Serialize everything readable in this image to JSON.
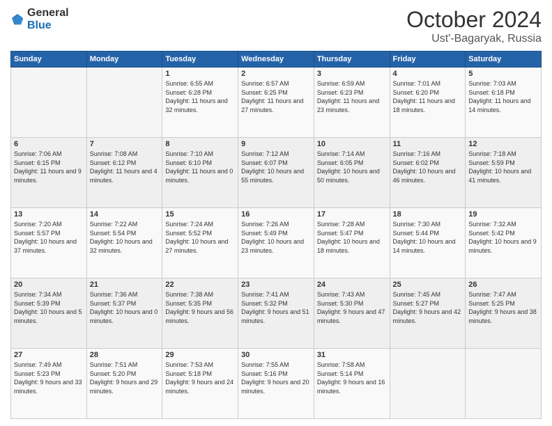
{
  "logo": {
    "general": "General",
    "blue": "Blue"
  },
  "header": {
    "month": "October 2024",
    "location": "Ust'-Bagaryak, Russia"
  },
  "weekdays": [
    "Sunday",
    "Monday",
    "Tuesday",
    "Wednesday",
    "Thursday",
    "Friday",
    "Saturday"
  ],
  "weeks": [
    [
      {
        "day": "",
        "sunrise": "",
        "sunset": "",
        "daylight": ""
      },
      {
        "day": "",
        "sunrise": "",
        "sunset": "",
        "daylight": ""
      },
      {
        "day": "1",
        "sunrise": "Sunrise: 6:55 AM",
        "sunset": "Sunset: 6:28 PM",
        "daylight": "Daylight: 11 hours and 32 minutes."
      },
      {
        "day": "2",
        "sunrise": "Sunrise: 6:57 AM",
        "sunset": "Sunset: 6:25 PM",
        "daylight": "Daylight: 11 hours and 27 minutes."
      },
      {
        "day": "3",
        "sunrise": "Sunrise: 6:59 AM",
        "sunset": "Sunset: 6:23 PM",
        "daylight": "Daylight: 11 hours and 23 minutes."
      },
      {
        "day": "4",
        "sunrise": "Sunrise: 7:01 AM",
        "sunset": "Sunset: 6:20 PM",
        "daylight": "Daylight: 11 hours and 18 minutes."
      },
      {
        "day": "5",
        "sunrise": "Sunrise: 7:03 AM",
        "sunset": "Sunset: 6:18 PM",
        "daylight": "Daylight: 11 hours and 14 minutes."
      }
    ],
    [
      {
        "day": "6",
        "sunrise": "Sunrise: 7:06 AM",
        "sunset": "Sunset: 6:15 PM",
        "daylight": "Daylight: 11 hours and 9 minutes."
      },
      {
        "day": "7",
        "sunrise": "Sunrise: 7:08 AM",
        "sunset": "Sunset: 6:12 PM",
        "daylight": "Daylight: 11 hours and 4 minutes."
      },
      {
        "day": "8",
        "sunrise": "Sunrise: 7:10 AM",
        "sunset": "Sunset: 6:10 PM",
        "daylight": "Daylight: 11 hours and 0 minutes."
      },
      {
        "day": "9",
        "sunrise": "Sunrise: 7:12 AM",
        "sunset": "Sunset: 6:07 PM",
        "daylight": "Daylight: 10 hours and 55 minutes."
      },
      {
        "day": "10",
        "sunrise": "Sunrise: 7:14 AM",
        "sunset": "Sunset: 6:05 PM",
        "daylight": "Daylight: 10 hours and 50 minutes."
      },
      {
        "day": "11",
        "sunrise": "Sunrise: 7:16 AM",
        "sunset": "Sunset: 6:02 PM",
        "daylight": "Daylight: 10 hours and 46 minutes."
      },
      {
        "day": "12",
        "sunrise": "Sunrise: 7:18 AM",
        "sunset": "Sunset: 5:59 PM",
        "daylight": "Daylight: 10 hours and 41 minutes."
      }
    ],
    [
      {
        "day": "13",
        "sunrise": "Sunrise: 7:20 AM",
        "sunset": "Sunset: 5:57 PM",
        "daylight": "Daylight: 10 hours and 37 minutes."
      },
      {
        "day": "14",
        "sunrise": "Sunrise: 7:22 AM",
        "sunset": "Sunset: 5:54 PM",
        "daylight": "Daylight: 10 hours and 32 minutes."
      },
      {
        "day": "15",
        "sunrise": "Sunrise: 7:24 AM",
        "sunset": "Sunset: 5:52 PM",
        "daylight": "Daylight: 10 hours and 27 minutes."
      },
      {
        "day": "16",
        "sunrise": "Sunrise: 7:26 AM",
        "sunset": "Sunset: 5:49 PM",
        "daylight": "Daylight: 10 hours and 23 minutes."
      },
      {
        "day": "17",
        "sunrise": "Sunrise: 7:28 AM",
        "sunset": "Sunset: 5:47 PM",
        "daylight": "Daylight: 10 hours and 18 minutes."
      },
      {
        "day": "18",
        "sunrise": "Sunrise: 7:30 AM",
        "sunset": "Sunset: 5:44 PM",
        "daylight": "Daylight: 10 hours and 14 minutes."
      },
      {
        "day": "19",
        "sunrise": "Sunrise: 7:32 AM",
        "sunset": "Sunset: 5:42 PM",
        "daylight": "Daylight: 10 hours and 9 minutes."
      }
    ],
    [
      {
        "day": "20",
        "sunrise": "Sunrise: 7:34 AM",
        "sunset": "Sunset: 5:39 PM",
        "daylight": "Daylight: 10 hours and 5 minutes."
      },
      {
        "day": "21",
        "sunrise": "Sunrise: 7:36 AM",
        "sunset": "Sunset: 5:37 PM",
        "daylight": "Daylight: 10 hours and 0 minutes."
      },
      {
        "day": "22",
        "sunrise": "Sunrise: 7:38 AM",
        "sunset": "Sunset: 5:35 PM",
        "daylight": "Daylight: 9 hours and 56 minutes."
      },
      {
        "day": "23",
        "sunrise": "Sunrise: 7:41 AM",
        "sunset": "Sunset: 5:32 PM",
        "daylight": "Daylight: 9 hours and 51 minutes."
      },
      {
        "day": "24",
        "sunrise": "Sunrise: 7:43 AM",
        "sunset": "Sunset: 5:30 PM",
        "daylight": "Daylight: 9 hours and 47 minutes."
      },
      {
        "day": "25",
        "sunrise": "Sunrise: 7:45 AM",
        "sunset": "Sunset: 5:27 PM",
        "daylight": "Daylight: 9 hours and 42 minutes."
      },
      {
        "day": "26",
        "sunrise": "Sunrise: 7:47 AM",
        "sunset": "Sunset: 5:25 PM",
        "daylight": "Daylight: 9 hours and 38 minutes."
      }
    ],
    [
      {
        "day": "27",
        "sunrise": "Sunrise: 7:49 AM",
        "sunset": "Sunset: 5:23 PM",
        "daylight": "Daylight: 9 hours and 33 minutes."
      },
      {
        "day": "28",
        "sunrise": "Sunrise: 7:51 AM",
        "sunset": "Sunset: 5:20 PM",
        "daylight": "Daylight: 9 hours and 29 minutes."
      },
      {
        "day": "29",
        "sunrise": "Sunrise: 7:53 AM",
        "sunset": "Sunset: 5:18 PM",
        "daylight": "Daylight: 9 hours and 24 minutes."
      },
      {
        "day": "30",
        "sunrise": "Sunrise: 7:55 AM",
        "sunset": "Sunset: 5:16 PM",
        "daylight": "Daylight: 9 hours and 20 minutes."
      },
      {
        "day": "31",
        "sunrise": "Sunrise: 7:58 AM",
        "sunset": "Sunset: 5:14 PM",
        "daylight": "Daylight: 9 hours and 16 minutes."
      },
      {
        "day": "",
        "sunrise": "",
        "sunset": "",
        "daylight": ""
      },
      {
        "day": "",
        "sunrise": "",
        "sunset": "",
        "daylight": ""
      }
    ]
  ]
}
